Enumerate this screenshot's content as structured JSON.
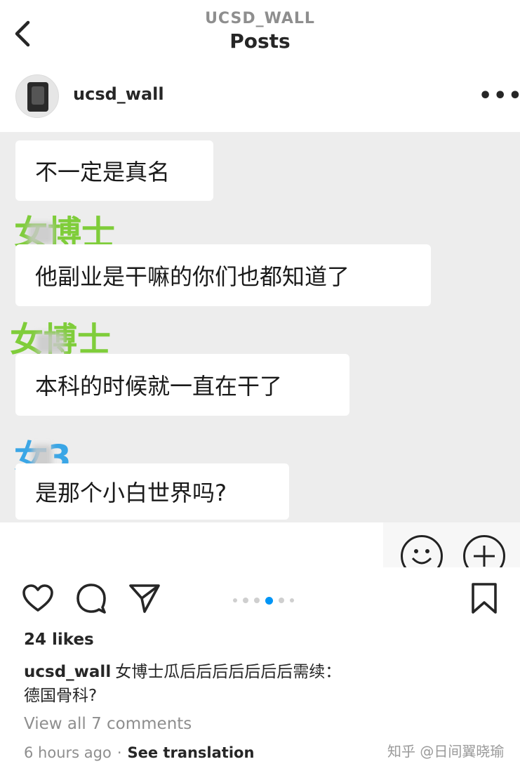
{
  "nav": {
    "account_handle": "UCSD_WALL",
    "title": "Posts"
  },
  "post": {
    "username": "ucsd_wall",
    "more_icon": "more-horizontal-icon"
  },
  "chat": {
    "messages": [
      {
        "sender": "",
        "text": "不一定是真名"
      },
      {
        "sender": "女博士",
        "text": "他副业是干嘛的你们也都知道了"
      },
      {
        "sender": "女博士",
        "text": "本科的时候就一直在干了"
      },
      {
        "sender": "女3",
        "text": "是那个小白世界吗?"
      }
    ],
    "sender_colors": {
      "green": "#7fcd3a",
      "blue": "#3aa6e6"
    },
    "icons": [
      "emoji-icon",
      "plus-circle-icon"
    ]
  },
  "actions": {
    "icons": [
      "heart-icon",
      "comment-icon",
      "share-icon",
      "bookmark-icon"
    ],
    "carousel": {
      "count": 6,
      "active_index": 3
    }
  },
  "likes": "24 likes",
  "caption": {
    "username": "ucsd_wall",
    "text": "女博士瓜后后后后后后后需续：",
    "line2": "德国骨科?"
  },
  "comments": {
    "view_all": "View all 7 comments"
  },
  "meta": {
    "time": "6 hours ago",
    "separator": "·",
    "see_translation": "See translation"
  },
  "watermark": "知乎 @日间翼晓瑜"
}
